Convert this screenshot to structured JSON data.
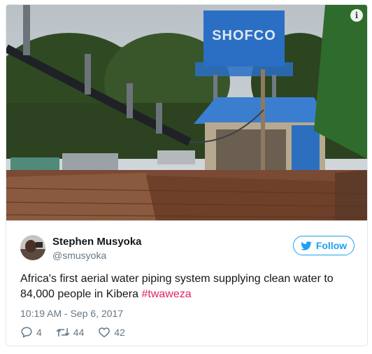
{
  "tweet": {
    "display_name": "Stephen Musyoka",
    "handle": "@smusyoka",
    "follow_label": "Follow",
    "text": "Africa's first aerial water piping system supplying clean water to 84,000 people in Kibera ",
    "hashtag": "#twaweza",
    "timestamp": "10:19 AM - Sep 6, 2017",
    "replies": "4",
    "retweets": "44",
    "likes": "42"
  },
  "photo": {
    "tank_label": "SHOFCO"
  },
  "icons": [
    "info-icon",
    "twitter-bird-icon",
    "reply-icon",
    "retweet-icon",
    "like-icon"
  ],
  "colors": {
    "accent": "#1da1f2",
    "hashtag": "#e0245e",
    "muted": "#657786",
    "text": "#14171a"
  }
}
